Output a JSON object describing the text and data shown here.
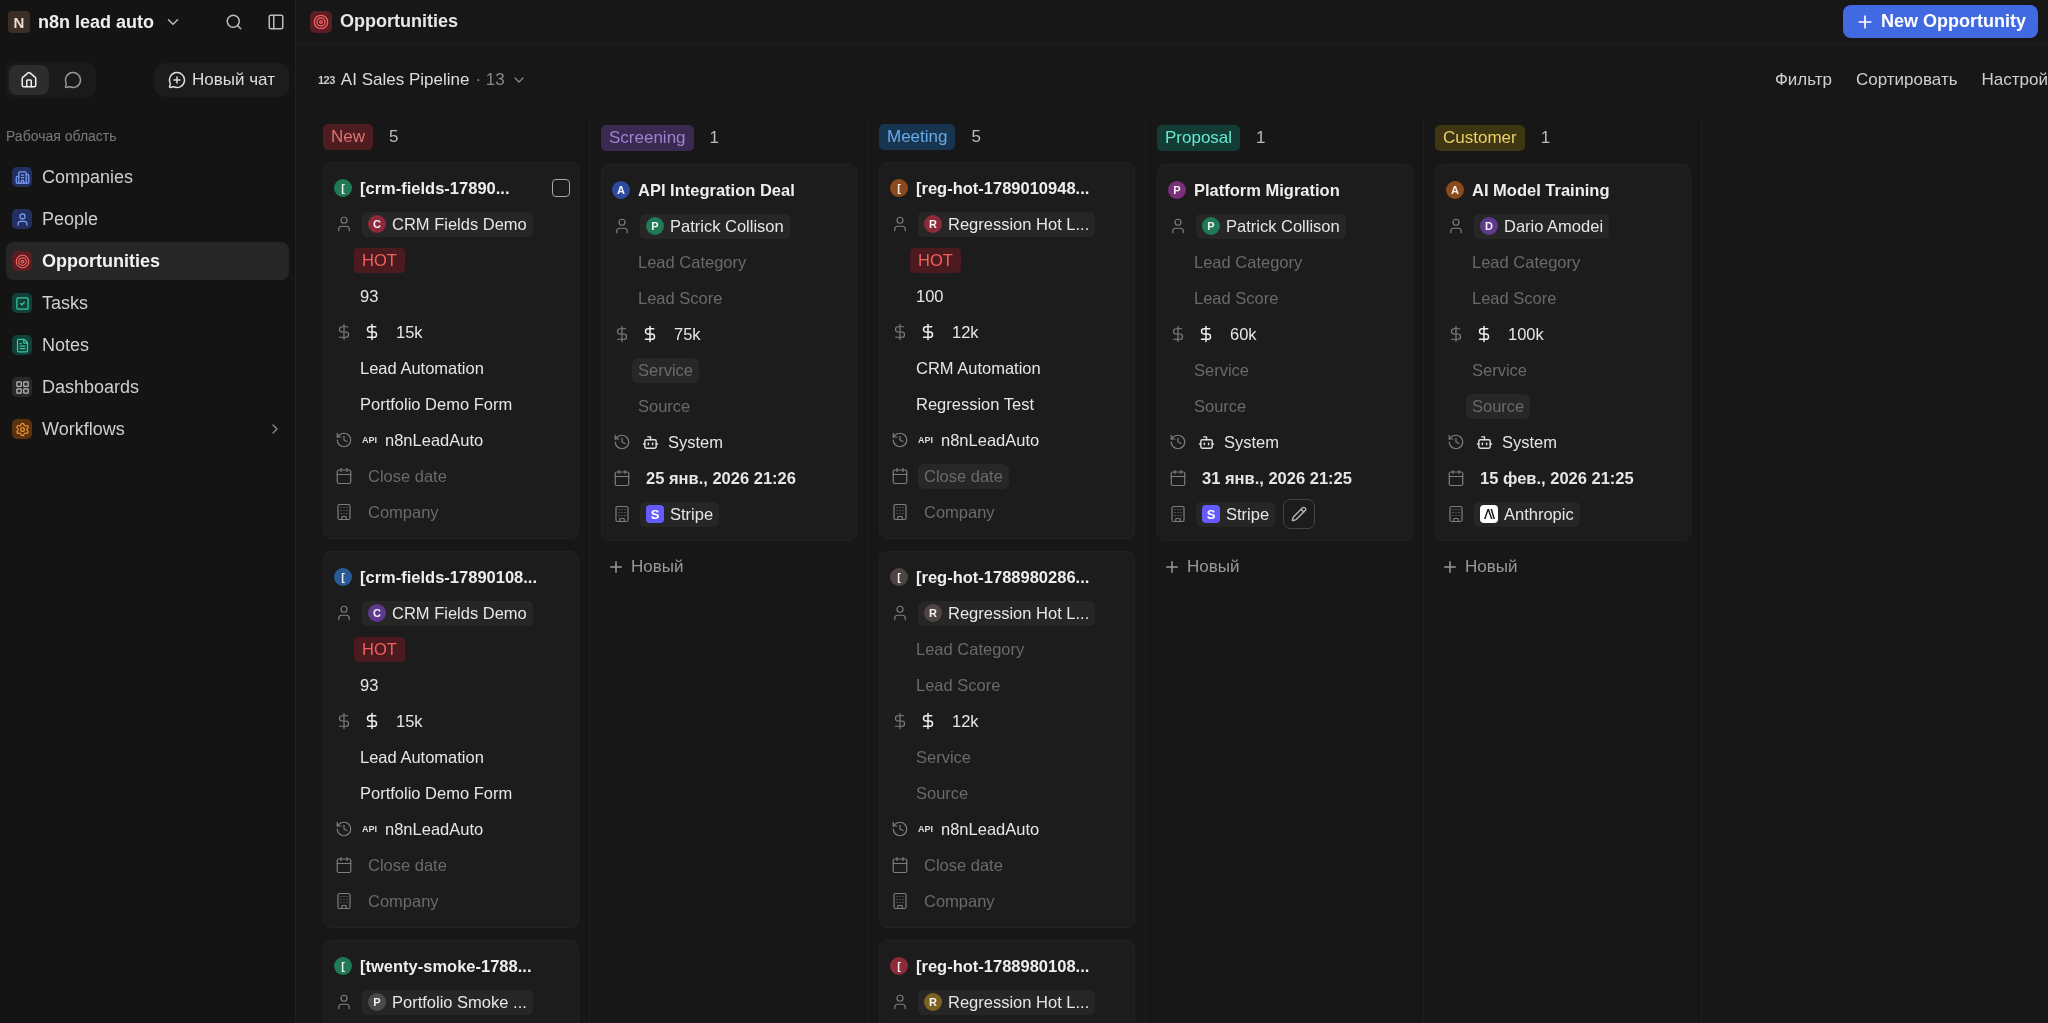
{
  "workspace": {
    "initial": "N",
    "name": "n8n lead auto"
  },
  "sidebar": {
    "tabs": [
      {
        "kind": "home",
        "selected": true
      },
      {
        "kind": "chat",
        "selected": false
      }
    ],
    "new_chat": "Новый чат",
    "section": "Рабочая область",
    "items": [
      {
        "kind": "companies",
        "label": "Companies",
        "selected": false
      },
      {
        "kind": "people",
        "label": "People",
        "selected": false
      },
      {
        "kind": "opportunities",
        "label": "Opportunities",
        "selected": true
      },
      {
        "kind": "tasks",
        "label": "Tasks",
        "selected": false
      },
      {
        "kind": "notes",
        "label": "Notes",
        "selected": false
      },
      {
        "kind": "dashboards",
        "label": "Dashboards",
        "selected": false
      },
      {
        "kind": "workflows",
        "label": "Workflows",
        "selected": false,
        "has_children": true
      }
    ]
  },
  "page": {
    "title": "Opportunities",
    "new_button": "New Opportunity"
  },
  "view": {
    "icon": "123",
    "name": "AI Sales Pipeline",
    "count": "· 13",
    "actions": [
      "Фильтр",
      "Сортировать",
      "Настрой"
    ]
  },
  "columns": [
    {
      "stage": "New",
      "color": "#4d1d1f",
      "count": "5",
      "cards": [
        {
          "avatar": "[",
          "color": "#1f7a55",
          "title": "[crm-fields-17890...",
          "checkbox": {
            "checked": false
          },
          "rows": [
            {
              "kind": "person",
              "avatar": "C",
              "color": "#8c2a3a",
              "value": "CRM Fields Demo"
            },
            {
              "kind": "tag",
              "value": "HOT"
            },
            {
              "kind": "text",
              "value": "93"
            },
            {
              "kind": "amount",
              "value": "15k"
            },
            {
              "kind": "text",
              "value": "Lead Automation"
            },
            {
              "kind": "text",
              "value": "Portfolio Demo Form"
            },
            {
              "kind": "creator_api",
              "badge": "API",
              "value": "n8nLeadAuto"
            },
            {
              "kind": "date",
              "placeholder": "Close date"
            },
            {
              "kind": "company",
              "placeholder": "Company"
            }
          ]
        },
        {
          "avatar": "[",
          "color": "#2a5a96",
          "title": "[crm-fields-17890108...",
          "rows": [
            {
              "kind": "person",
              "avatar": "C",
              "color": "#5e3a8c",
              "value": "CRM Fields Demo"
            },
            {
              "kind": "tag",
              "value": "HOT"
            },
            {
              "kind": "text",
              "value": "93"
            },
            {
              "kind": "amount",
              "value": "15k"
            },
            {
              "kind": "text",
              "value": "Lead Automation"
            },
            {
              "kind": "text",
              "value": "Portfolio Demo Form"
            },
            {
              "kind": "creator_api",
              "badge": "API",
              "value": "n8nLeadAuto"
            },
            {
              "kind": "date",
              "placeholder": "Close date"
            },
            {
              "kind": "company",
              "placeholder": "Company"
            }
          ]
        },
        {
          "avatar": "[",
          "color": "#1f7a55",
          "title": "[twenty-smoke-1788...",
          "rows": [
            {
              "kind": "person",
              "avatar": "P",
              "color": "#4a4a4a",
              "value": "Portfolio Smoke ..."
            }
          ]
        }
      ]
    },
    {
      "stage": "Screening",
      "color": "#3a2950",
      "count": "1",
      "add_label": "Новый",
      "cards": [
        {
          "avatar": "A",
          "color": "#2e4aa0",
          "title": "API Integration Deal",
          "rows": [
            {
              "kind": "person",
              "avatar": "P",
              "color": "#1f7a55",
              "value": "Patrick Collison"
            },
            {
              "kind": "text",
              "placeholder": "Lead Category"
            },
            {
              "kind": "text",
              "placeholder": "Lead Score"
            },
            {
              "kind": "amount",
              "value": "75k"
            },
            {
              "kind": "text",
              "placeholder": "Service",
              "hovered": true
            },
            {
              "kind": "text",
              "placeholder": "Source"
            },
            {
              "kind": "creator_system",
              "value": "System"
            },
            {
              "kind": "date",
              "value": "25 янв., 2026 21:26"
            },
            {
              "kind": "company",
              "logo": {
                "kind": "letter",
                "letter": "S",
                "color": "#635bff"
              },
              "value": "Stripe"
            }
          ]
        }
      ]
    },
    {
      "stage": "Meeting",
      "color": "#183550",
      "count": "5",
      "cards": [
        {
          "avatar": "[",
          "color": "#8c4a1c",
          "title": "[reg-hot-1789010948...",
          "rows": [
            {
              "kind": "person",
              "avatar": "R",
              "color": "#8c2a3a",
              "value": "Regression Hot L..."
            },
            {
              "kind": "tag",
              "value": "HOT"
            },
            {
              "kind": "text",
              "value": "100"
            },
            {
              "kind": "amount",
              "value": "12k"
            },
            {
              "kind": "text",
              "value": "CRM Automation"
            },
            {
              "kind": "text",
              "value": "Regression Test"
            },
            {
              "kind": "creator_api",
              "badge": "API",
              "value": "n8nLeadAuto"
            },
            {
              "kind": "date",
              "placeholder": "Close date",
              "hovered": true
            },
            {
              "kind": "company",
              "placeholder": "Company"
            }
          ]
        },
        {
          "avatar": "[",
          "color": "#4e4542",
          "title": "[reg-hot-1788980286...",
          "rows": [
            {
              "kind": "person",
              "avatar": "R",
              "color": "#4e4542",
              "value": "Regression Hot L..."
            },
            {
              "kind": "text",
              "placeholder": "Lead Category"
            },
            {
              "kind": "text",
              "placeholder": "Lead Score"
            },
            {
              "kind": "amount",
              "value": "12k"
            },
            {
              "kind": "text",
              "placeholder": "Service"
            },
            {
              "kind": "text",
              "placeholder": "Source"
            },
            {
              "kind": "creator_api",
              "badge": "API",
              "value": "n8nLeadAuto"
            },
            {
              "kind": "date",
              "placeholder": "Close date"
            },
            {
              "kind": "company",
              "placeholder": "Company"
            }
          ]
        },
        {
          "avatar": "[",
          "color": "#8c2a3a",
          "title": "[reg-hot-1788980108...",
          "rows": [
            {
              "kind": "person",
              "avatar": "R",
              "color": "#7a6220",
              "value": "Regression Hot L..."
            }
          ]
        }
      ]
    },
    {
      "stage": "Proposal",
      "color": "#123c34",
      "count": "1",
      "add_label": "Новый",
      "cards": [
        {
          "avatar": "P",
          "color": "#7a2f7a",
          "title": "Platform Migration",
          "rows": [
            {
              "kind": "person",
              "avatar": "P",
              "color": "#1f7a55",
              "value": "Patrick Collison"
            },
            {
              "kind": "text",
              "placeholder": "Lead Category"
            },
            {
              "kind": "text",
              "placeholder": "Lead Score"
            },
            {
              "kind": "amount",
              "value": "60k"
            },
            {
              "kind": "text",
              "placeholder": "Service"
            },
            {
              "kind": "text",
              "placeholder": "Source"
            },
            {
              "kind": "creator_system",
              "value": "System"
            },
            {
              "kind": "date",
              "value": "31 янв., 2026 21:25"
            },
            {
              "kind": "company",
              "logo": {
                "kind": "letter",
                "letter": "S",
                "color": "#635bff"
              },
              "value": "Stripe",
              "edit": true
            }
          ]
        }
      ]
    },
    {
      "stage": "Customer",
      "color": "#3e3512",
      "count": "1",
      "add_label": "Новый",
      "cards": [
        {
          "avatar": "A",
          "color": "#8c4a1c",
          "title": "AI Model Training",
          "rows": [
            {
              "kind": "person",
              "avatar": "D",
              "color": "#5e3a8c",
              "value": "Dario Amodei"
            },
            {
              "kind": "text",
              "placeholder": "Lead Category"
            },
            {
              "kind": "text",
              "placeholder": "Lead Score"
            },
            {
              "kind": "amount",
              "value": "100k"
            },
            {
              "kind": "text",
              "placeholder": "Service"
            },
            {
              "kind": "text",
              "placeholder": "Source",
              "hovered": true
            },
            {
              "kind": "creator_system",
              "value": "System"
            },
            {
              "kind": "date",
              "value": "15 фев., 2026 21:25"
            },
            {
              "kind": "company",
              "logo": {
                "kind": "mark"
              },
              "value": "Anthropic"
            }
          ]
        }
      ]
    }
  ]
}
